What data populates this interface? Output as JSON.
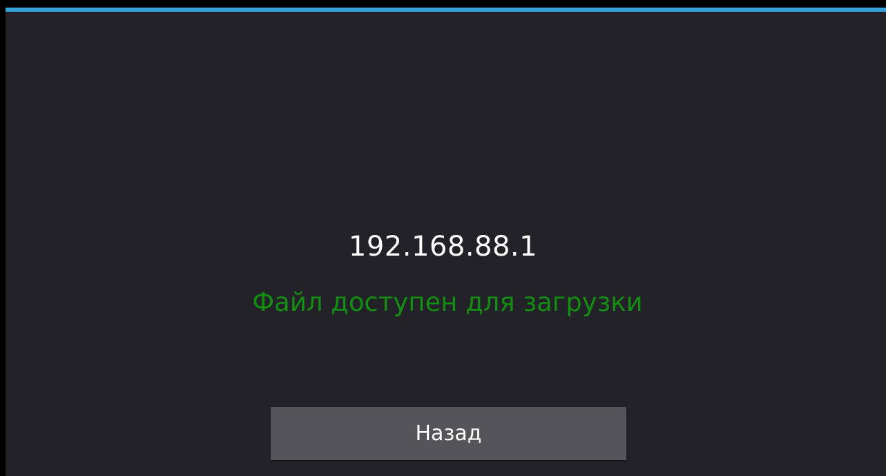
{
  "theme": {
    "background": "#232228",
    "accent": "#33a3d8",
    "status_color": "#138e13",
    "button_background": "#555458",
    "text_color": "#ffffff"
  },
  "main": {
    "ip_address": "192.168.88.1",
    "status": "Файл доступен для загрузки"
  },
  "actions": {
    "back_label": "Назад"
  }
}
